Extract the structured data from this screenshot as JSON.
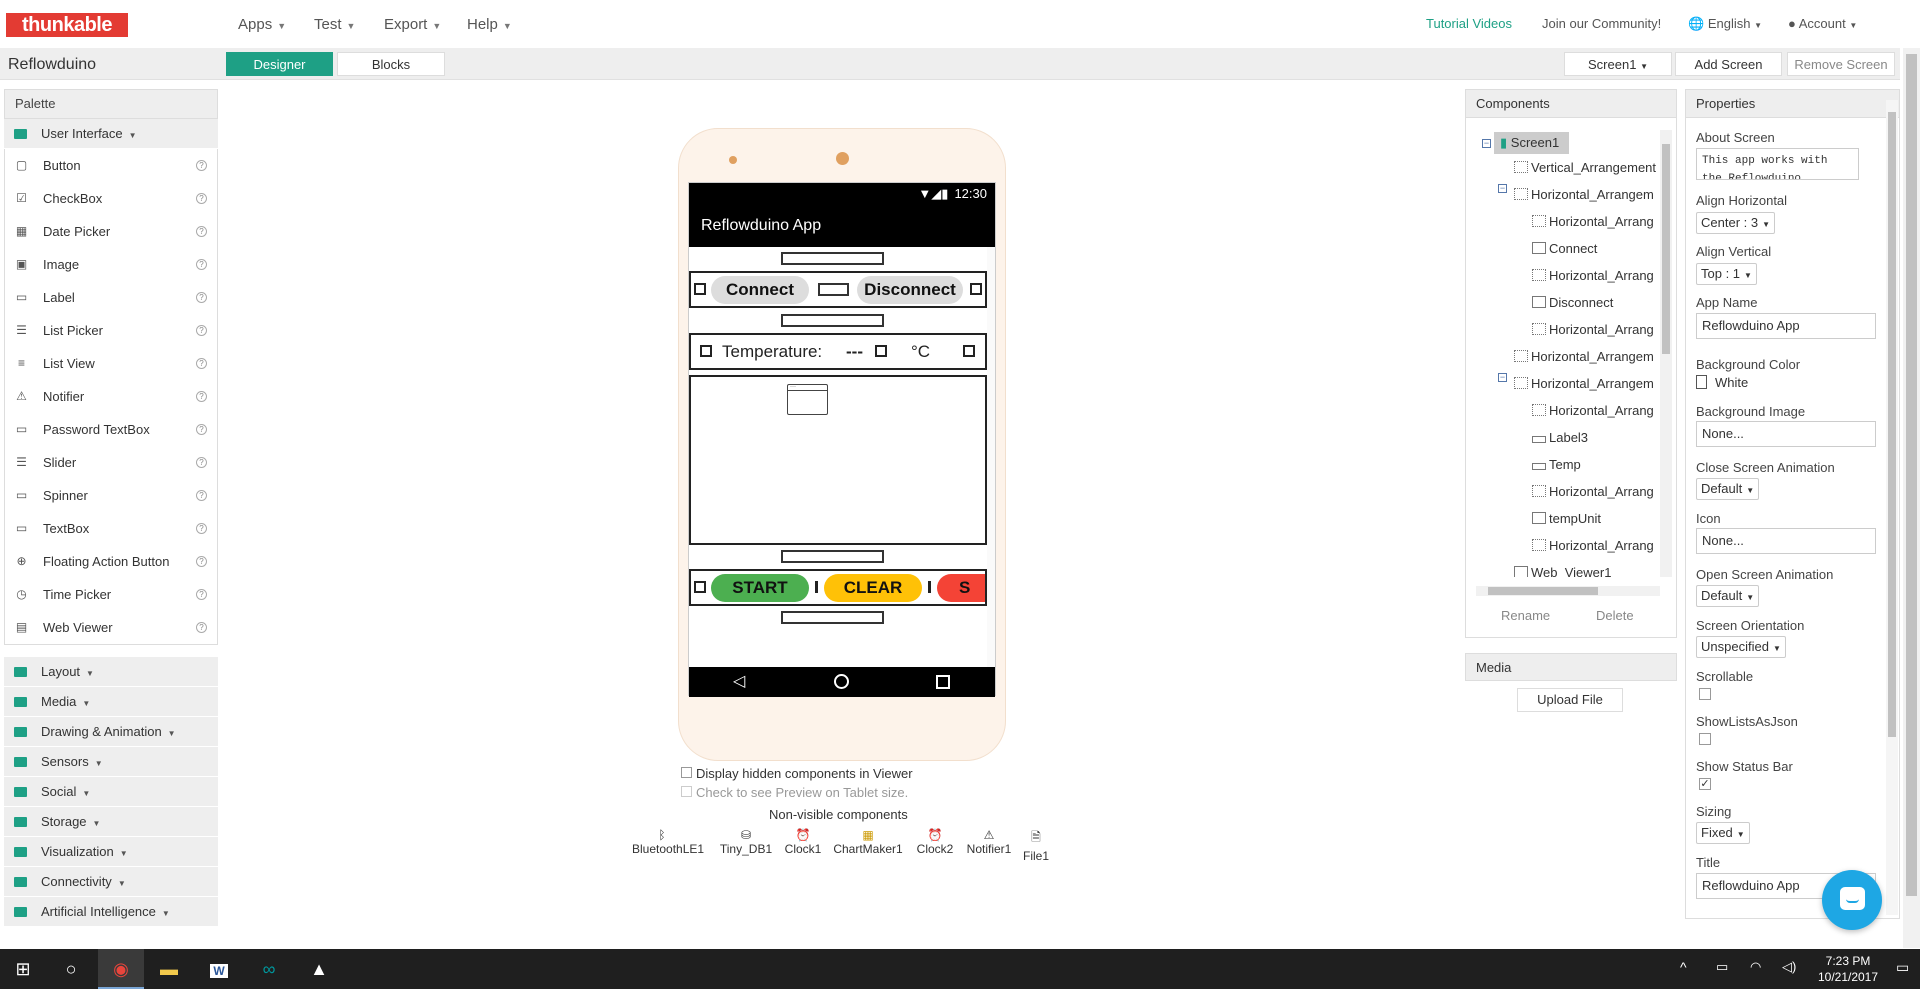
{
  "topbar": {
    "logo": "thunkable",
    "menus": [
      "Apps",
      "Test",
      "Export",
      "Help"
    ],
    "tutorial": "Tutorial Videos",
    "community": "Join our Community!",
    "language": "English",
    "account": "Account"
  },
  "toolbar": {
    "project": "Reflowduino",
    "designer": "Designer",
    "blocks": "Blocks",
    "screen": "Screen1",
    "add_screen": "Add Screen",
    "remove_screen": "Remove Screen"
  },
  "palette": {
    "title": "Palette",
    "open_category": "User Interface",
    "items": [
      "Button",
      "CheckBox",
      "Date Picker",
      "Image",
      "Label",
      "List Picker",
      "List View",
      "Notifier",
      "Password TextBox",
      "Slider",
      "Spinner",
      "TextBox",
      "Floating Action Button",
      "Time Picker",
      "Web Viewer"
    ],
    "categories": [
      "Layout",
      "Media",
      "Drawing & Animation",
      "Sensors",
      "Social",
      "Storage",
      "Visualization",
      "Connectivity",
      "Artificial Intelligence"
    ]
  },
  "viewer": {
    "status_time": "12:30",
    "app_title": "Reflowduino App",
    "connect": "Connect",
    "disconnect": "Disconnect",
    "temperature_label": "Temperature:",
    "temp_value": "---",
    "temp_unit": "°C",
    "start": "START",
    "clear": "CLEAR",
    "stop_partial": "S",
    "display_hidden": "Display hidden components in Viewer",
    "tablet_preview": "Check to see Preview on Tablet size.",
    "nonvisible_title": "Non-visible components",
    "nonvisible": [
      "BluetoothLE1",
      "Tiny_DB1",
      "Clock1",
      "ChartMaker1",
      "Clock2",
      "Notifier1",
      "File1"
    ]
  },
  "components": {
    "title": "Components",
    "tree": [
      "Screen1",
      "Vertical_Arrangement",
      "Horizontal_Arrangem",
      "Horizontal_Arrang",
      "Connect",
      "Horizontal_Arrang",
      "Disconnect",
      "Horizontal_Arrang",
      "Horizontal_Arrangem",
      "Horizontal_Arrangem",
      "Horizontal_Arrang",
      "Label3",
      "Temp",
      "Horizontal_Arrang",
      "tempUnit",
      "Horizontal_Arrang",
      "Web_Viewer1"
    ],
    "rename": "Rename",
    "delete": "Delete"
  },
  "media": {
    "title": "Media",
    "upload": "Upload File"
  },
  "properties": {
    "title": "Properties",
    "about_label": "About Screen",
    "about_value": "This app works with the Reflowduino",
    "align_h_label": "Align Horizontal",
    "align_h_value": "Center : 3",
    "align_v_label": "Align Vertical",
    "align_v_value": "Top : 1",
    "app_name_label": "App Name",
    "app_name_value": "Reflowduino App",
    "bg_color_label": "Background Color",
    "bg_color_value": "White",
    "bg_image_label": "Background Image",
    "bg_image_value": "None...",
    "close_anim_label": "Close Screen Animation",
    "close_anim_value": "Default",
    "icon_label": "Icon",
    "icon_value": "None...",
    "open_anim_label": "Open Screen Animation",
    "open_anim_value": "Default",
    "orientation_label": "Screen Orientation",
    "orientation_value": "Unspecified",
    "scrollable_label": "Scrollable",
    "showlists_label": "ShowListsAsJson",
    "statusbar_label": "Show Status Bar",
    "sizing_label": "Sizing",
    "sizing_value": "Fixed",
    "title_label": "Title",
    "title_value": "Reflowduino App"
  },
  "taskbar": {
    "time": "7:23 PM",
    "date": "10/21/2017"
  },
  "colors": {
    "accent": "#1ea085",
    "logo": "#e33b33",
    "start": "#4caf50",
    "clear": "#ffc107",
    "stop": "#f44336"
  }
}
